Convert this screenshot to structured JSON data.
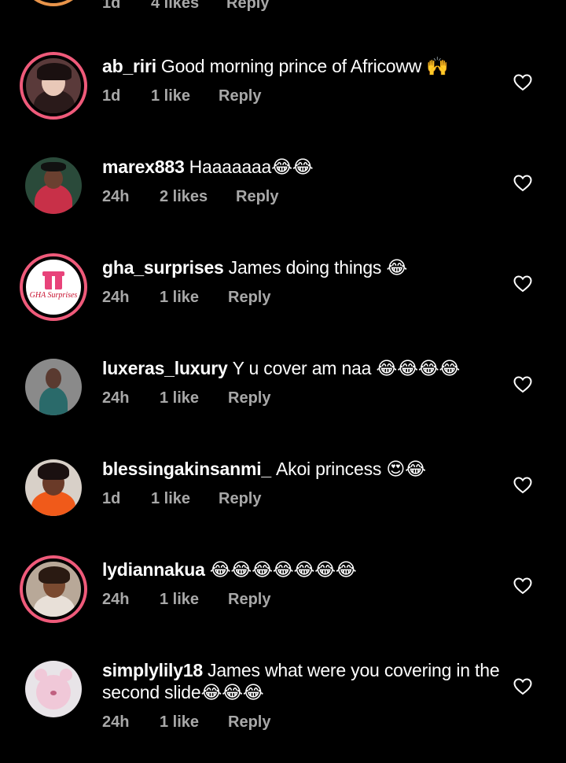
{
  "partial_top": {
    "time": "1d",
    "likes": "4 likes",
    "reply": "Reply"
  },
  "comments": [
    {
      "username": "ab_riri",
      "text": "Good morning prince of Africoww 🙌",
      "time": "1d",
      "likes": "1 like",
      "reply": "Reply"
    },
    {
      "username": "marex883",
      "text": "Haaaaaaa😂😂",
      "time": "24h",
      "likes": "2 likes",
      "reply": "Reply"
    },
    {
      "username": "gha_surprises",
      "text": "James doing things 😂",
      "time": "24h",
      "likes": "1 like",
      "reply": "Reply",
      "avatar_label": "GHA Surprises"
    },
    {
      "username": "luxeras_luxury",
      "text": "Y u cover am naa 😂😂😂😂",
      "time": "24h",
      "likes": "1 like",
      "reply": "Reply"
    },
    {
      "username": "blessingakinsanmi_",
      "text": "Akoi princess 😍😂",
      "time": "1d",
      "likes": "1 like",
      "reply": "Reply"
    },
    {
      "username": "lydiannakua",
      "text": "😂😂😂😂😂😂😂",
      "time": "24h",
      "likes": "1 like",
      "reply": "Reply"
    },
    {
      "username": "simplylily18",
      "text": "James what were you covering in the second slide😂😂😂",
      "time": "24h",
      "likes": "1 like",
      "reply": "Reply"
    }
  ],
  "colors": {
    "background": "#000000",
    "meta_text": "#a8a8a8",
    "story_ring": "#ef5a7a"
  },
  "icons": {
    "like": "heart-outline-icon"
  }
}
